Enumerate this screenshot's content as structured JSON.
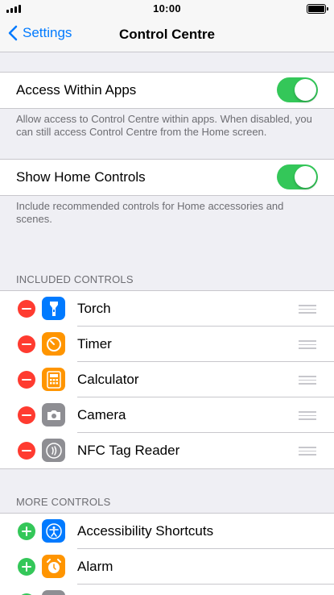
{
  "status_bar": {
    "time": "10:00"
  },
  "nav": {
    "back_label": "Settings",
    "title": "Control Centre"
  },
  "access_within_apps": {
    "label": "Access Within Apps",
    "enabled": true,
    "footer": "Allow access to Control Centre within apps. When disabled, you can still access Control Centre from the Home screen."
  },
  "show_home_controls": {
    "label": "Show Home Controls",
    "enabled": true,
    "footer": "Include recommended controls for Home accessories and scenes."
  },
  "included_controls": {
    "header": "INCLUDED CONTROLS",
    "items": [
      {
        "label": "Torch",
        "icon": "torch-icon",
        "color": "#007aff"
      },
      {
        "label": "Timer",
        "icon": "timer-icon",
        "color": "#ff9500"
      },
      {
        "label": "Calculator",
        "icon": "calculator-icon",
        "color": "#ff9500"
      },
      {
        "label": "Camera",
        "icon": "camera-icon",
        "color": "#8e8e93"
      },
      {
        "label": "NFC Tag Reader",
        "icon": "nfc-icon",
        "color": "#8e8e93"
      }
    ]
  },
  "more_controls": {
    "header": "MORE CONTROLS",
    "items": [
      {
        "label": "Accessibility Shortcuts",
        "icon": "accessibility-icon",
        "color": "#007aff"
      },
      {
        "label": "Alarm",
        "icon": "alarm-icon",
        "color": "#ff9500"
      }
    ]
  },
  "colors": {
    "accent": "#007aff",
    "toggle_on": "#34c759",
    "remove": "#ff3b30",
    "add": "#34c759"
  }
}
